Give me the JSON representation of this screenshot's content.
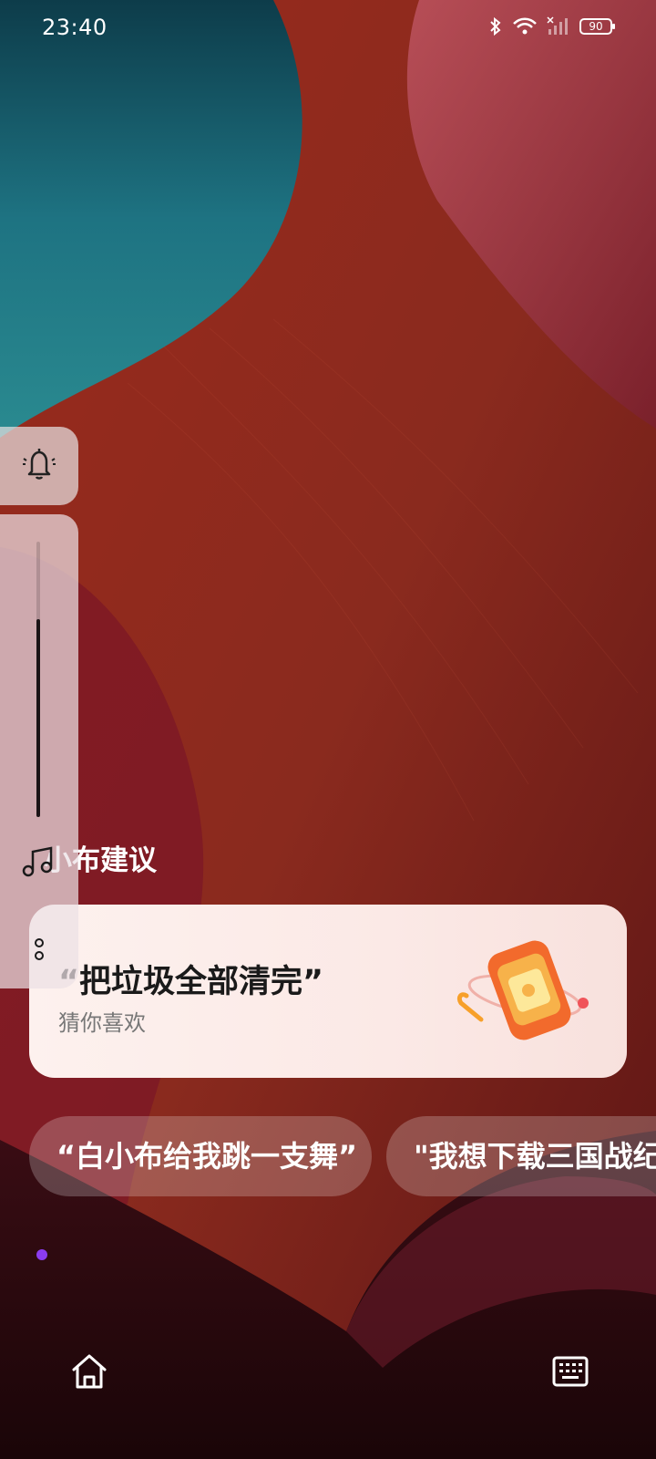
{
  "status_bar": {
    "time": "23:40",
    "battery": "90",
    "icons": [
      "bluetooth-icon",
      "wifi-icon",
      "cellular-signal-icon",
      "battery-icon"
    ]
  },
  "volume_panel": {
    "level": 0.72,
    "icons": [
      "bell-icon",
      "music-note-icon",
      "more-options-icon"
    ]
  },
  "suggestions": {
    "section_title": "小布建议",
    "main_card": {
      "title": "“把垃圾全部清完”",
      "subtitle": "猜你喜欢"
    },
    "chips": [
      "“白小布给我跳一支舞”",
      "\"我想下载三国战纪"
    ]
  },
  "page_indicator_color": "#8b3cf0",
  "bottom_bar": {
    "icons": [
      "home-icon",
      "keyboard-icon"
    ]
  },
  "colors": {
    "wallpaper_red": "#8c261c",
    "wallpaper_teal": "#1f6f7a",
    "card_background": "#fcefeb",
    "chip_background": "rgba(255,255,255,0.22)"
  }
}
